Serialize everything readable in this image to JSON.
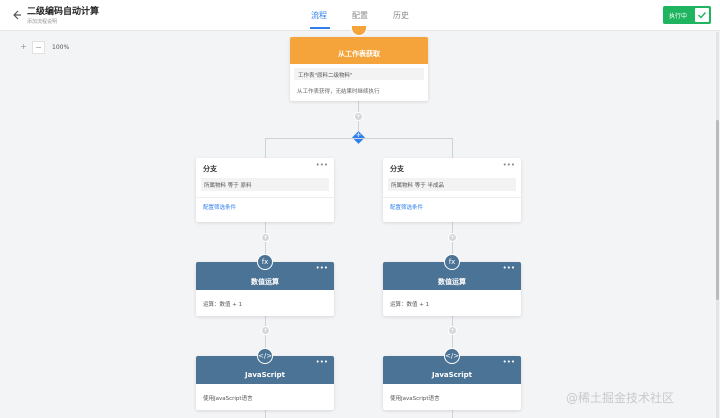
{
  "header": {
    "title": "二级编码自动计算",
    "subtitle": "添加流程说明",
    "tabs": [
      "流程",
      "配置",
      "历史"
    ],
    "active_tab": "流程",
    "run_label": "执行中"
  },
  "zoom": {
    "plus": "+",
    "minus": "−",
    "level": "100%"
  },
  "source_node": {
    "title": "从工作表获取",
    "condition": "工作表\"原料二级物料\"",
    "note": "从工作表获得，无结果时继续执行"
  },
  "branches": [
    {
      "title": "分支",
      "condition": "所属物料 等于 原料",
      "link": "配置筛选条件",
      "calc_title": "数值运算",
      "calc_body": "运算：数值 + 1",
      "js_title": "JavaScript",
      "js_body": "使用JavaScript语言"
    },
    {
      "title": "分支",
      "condition": "所属物料 等于 半成品",
      "link": "配置筛选条件",
      "calc_title": "数值运算",
      "calc_body": "运算：数值 + 1",
      "js_title": "JavaScript",
      "js_body": "使用JavaScript语言"
    }
  ],
  "icons": {
    "menu": "•••",
    "calc": "fx",
    "code": "</>",
    "plus": "+"
  },
  "colors": {
    "accent": "#2f80ed",
    "source_header": "#f4a43a",
    "action_header": "#4a7396",
    "run_button": "#1fb45f"
  },
  "watermark": "@稀土掘金技术社区"
}
